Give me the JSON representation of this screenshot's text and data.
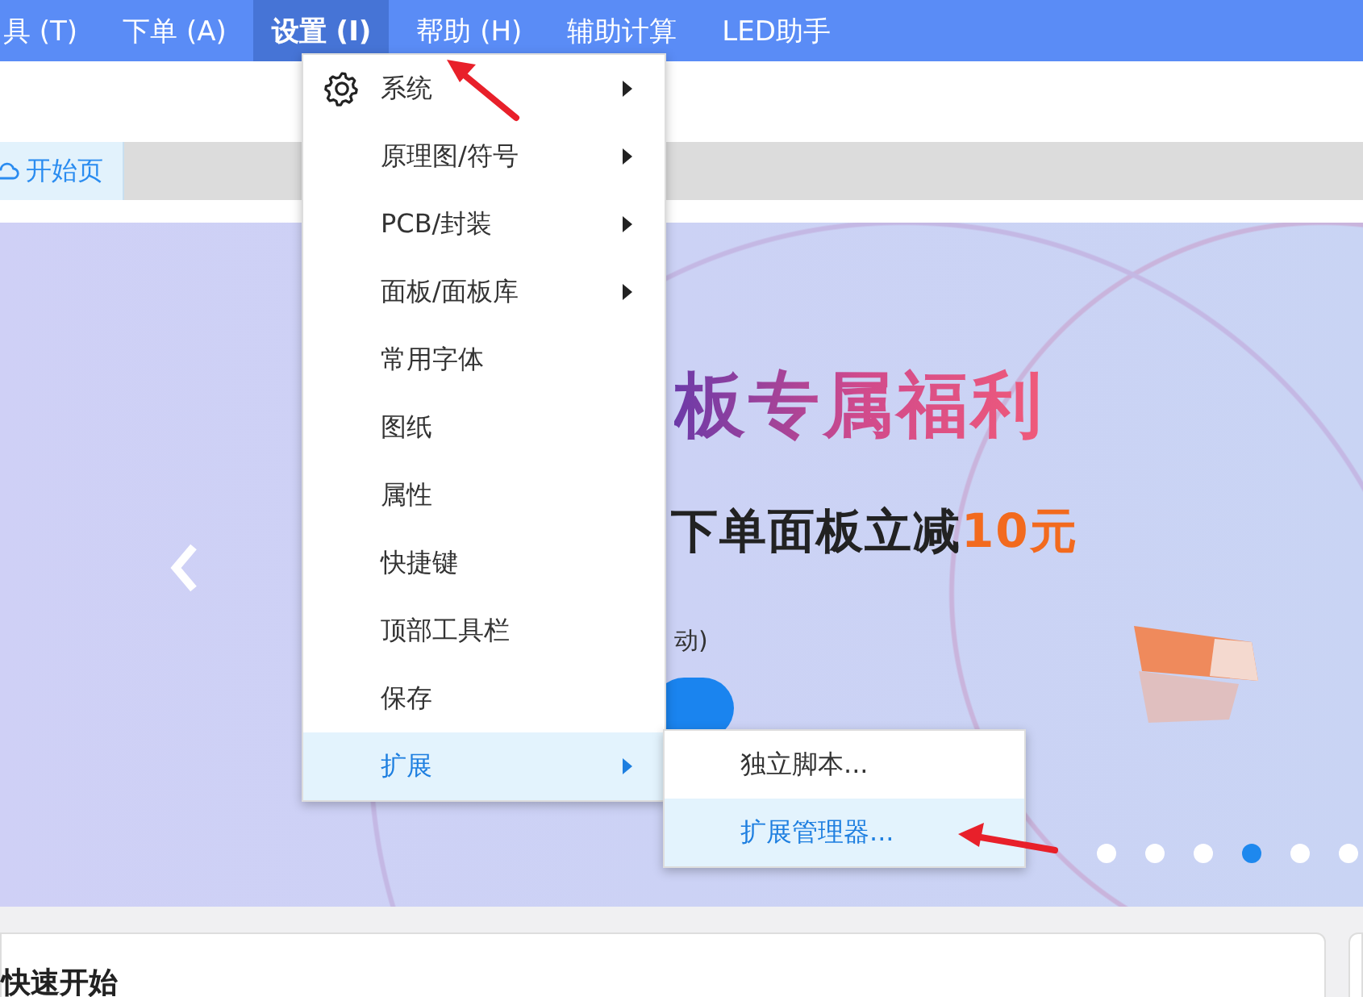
{
  "menubar": [
    {
      "label": "具 (T)",
      "selected": false
    },
    {
      "label": "下单 (A)",
      "selected": false
    },
    {
      "label": "设置 (I)",
      "selected": true
    },
    {
      "label": "帮助 (H)",
      "selected": false
    },
    {
      "label": "辅助计算",
      "selected": false
    },
    {
      "label": "LED助手",
      "selected": false
    }
  ],
  "tabs": [
    {
      "label": "开始页",
      "selected": true
    }
  ],
  "menu": {
    "items": [
      {
        "label": "系统",
        "kind": "gear",
        "submenu": true,
        "selected": false
      },
      {
        "label": "原理图/符号",
        "kind": "plain",
        "submenu": true,
        "selected": false
      },
      {
        "label": "PCB/封装",
        "kind": "plain",
        "submenu": true,
        "selected": false
      },
      {
        "label": "面板/面板库",
        "kind": "plain",
        "submenu": true,
        "selected": false
      },
      {
        "label": "常用字体",
        "kind": "plain",
        "submenu": false,
        "selected": false
      },
      {
        "label": "图纸",
        "kind": "plain",
        "submenu": false,
        "selected": false
      },
      {
        "label": "属性",
        "kind": "plain",
        "submenu": false,
        "selected": false
      },
      {
        "label": "快捷键",
        "kind": "plain",
        "submenu": false,
        "selected": false
      },
      {
        "label": "顶部工具栏",
        "kind": "plain",
        "submenu": false,
        "selected": false
      },
      {
        "label": "保存",
        "kind": "plain",
        "submenu": false,
        "selected": false
      },
      {
        "label": "扩展",
        "kind": "plain",
        "submenu": true,
        "selected": true
      }
    ],
    "submenu": [
      {
        "label": "独立脚本...",
        "selected": false
      },
      {
        "label": "扩展管理器...",
        "selected": true
      }
    ]
  },
  "banner": {
    "title": "板专属福利",
    "subtitle": "下单面板立减",
    "highlight": "10元",
    "note": "动)",
    "dots": [
      {
        "selected": false
      },
      {
        "selected": false
      },
      {
        "selected": false
      },
      {
        "selected": true
      },
      {
        "selected": false
      },
      {
        "selected": false
      }
    ]
  },
  "cards": [
    {
      "title": "快速开始"
    }
  ]
}
